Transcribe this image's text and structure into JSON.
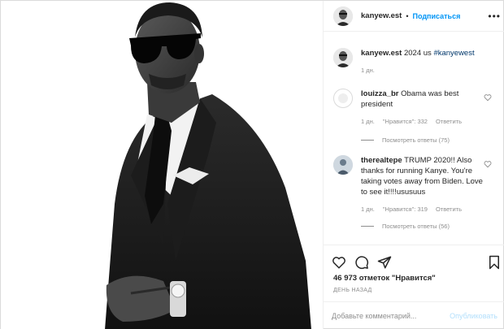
{
  "header": {
    "username": "kanyew.est",
    "separator": "•",
    "follow_label": "Подписаться",
    "more_label": "•••"
  },
  "caption": {
    "username": "kanyew.est",
    "text": "2024 us ",
    "hashtag": "#kanyewest",
    "time": "1 дн."
  },
  "comments": [
    {
      "username": "louizza_br",
      "text": "Obama was best president",
      "time": "1 дн.",
      "likes": "\"Нравится\": 332",
      "reply": "Ответить",
      "view_replies": "Посмотреть ответы (75)"
    },
    {
      "username": "therealtepe",
      "text": "TRUMP 2020!! Also thanks for running Kanye. You're taking votes away from Biden. Love to see it!!!!ususuus",
      "time": "1 дн.",
      "likes": "\"Нравится\": 319",
      "reply": "Ответить",
      "view_replies": "Посмотреть ответы (56)"
    }
  ],
  "actions": {
    "likes": "46 973 отметок \"Нравится\"",
    "date": "ДЕНЬ НАЗАД"
  },
  "add_comment": {
    "placeholder": "Добавьте комментарий...",
    "publish": "Опубликовать"
  }
}
